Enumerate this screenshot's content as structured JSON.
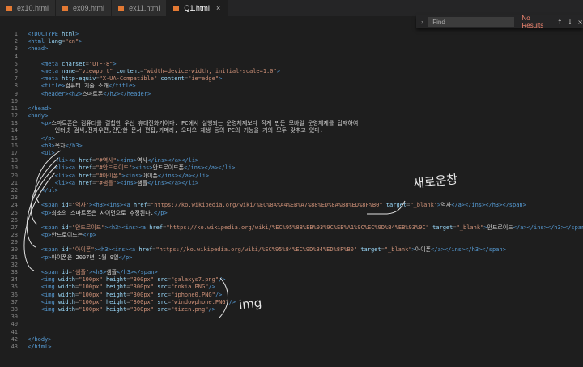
{
  "tabs": [
    {
      "label": "ex10.html",
      "active": false
    },
    {
      "label": "ex09.html",
      "active": false
    },
    {
      "label": "ex11.html",
      "active": false
    },
    {
      "label": "Q1.html",
      "active": true
    }
  ],
  "close_glyph": "×",
  "find": {
    "placeholder": "Find",
    "result": "No Results"
  },
  "annotations": {
    "new_window": "새로운창",
    "img": "img"
  },
  "lines": [
    {
      "n": "1",
      "tokens": [
        [
          "tg",
          "<!DOCTYPE "
        ],
        [
          "at",
          "html"
        ],
        [
          "tg",
          ">"
        ]
      ]
    },
    {
      "n": "2",
      "tokens": [
        [
          "tg",
          "<html "
        ],
        [
          "at",
          "lang"
        ],
        [
          "pu",
          "="
        ],
        [
          "st",
          "\"en\""
        ],
        [
          "tg",
          ">"
        ]
      ]
    },
    {
      "n": "3",
      "tokens": [
        [
          "tg",
          "<head>"
        ]
      ]
    },
    {
      "n": "4",
      "tokens": []
    },
    {
      "n": "5",
      "tokens": [
        [
          "tx",
          "    "
        ],
        [
          "tg",
          "<meta "
        ],
        [
          "at",
          "charset"
        ],
        [
          "pu",
          "="
        ],
        [
          "st",
          "\"UTF-8\""
        ],
        [
          "tg",
          ">"
        ]
      ]
    },
    {
      "n": "6",
      "tokens": [
        [
          "tx",
          "    "
        ],
        [
          "tg",
          "<meta "
        ],
        [
          "at",
          "name"
        ],
        [
          "pu",
          "="
        ],
        [
          "st",
          "\"viewport\" "
        ],
        [
          "at",
          "content"
        ],
        [
          "pu",
          "="
        ],
        [
          "st",
          "\"width=device-width, initial-scale=1.0\""
        ],
        [
          "tg",
          ">"
        ]
      ]
    },
    {
      "n": "7",
      "tokens": [
        [
          "tx",
          "    "
        ],
        [
          "tg",
          "<meta "
        ],
        [
          "at",
          "http-equiv"
        ],
        [
          "pu",
          "="
        ],
        [
          "st",
          "\"X-UA-Compatible\" "
        ],
        [
          "at",
          "content"
        ],
        [
          "pu",
          "="
        ],
        [
          "st",
          "\"ie=edge\""
        ],
        [
          "tg",
          ">"
        ]
      ]
    },
    {
      "n": "8",
      "tokens": [
        [
          "tx",
          "    "
        ],
        [
          "tg",
          "<title>"
        ],
        [
          "tx",
          "컴퓨터 기술 소개"
        ],
        [
          "tg",
          "</title>"
        ]
      ]
    },
    {
      "n": "9",
      "tokens": [
        [
          "tx",
          "    "
        ],
        [
          "tg",
          "<header><h2>"
        ],
        [
          "tx",
          "스마트폰"
        ],
        [
          "tg",
          "</h2></header>"
        ]
      ]
    },
    {
      "n": "10",
      "tokens": []
    },
    {
      "n": "11",
      "tokens": [
        [
          "tg",
          "</head>"
        ]
      ]
    },
    {
      "n": "12",
      "tokens": [
        [
          "tg",
          "<body>"
        ]
      ]
    },
    {
      "n": "13",
      "tokens": [
        [
          "tx",
          "    "
        ],
        [
          "tg",
          "<p>"
        ],
        [
          "tx",
          "스마트폰은 컴퓨터를 결합한 우선 휴대전화기이다. PC에서 실행되는 운영체제보다 작게 만든 모바일 운영체제를 탑재하여"
        ]
      ]
    },
    {
      "n": "14",
      "tokens": [
        [
          "tx",
          "        인터넷 검색,전자우편,간단한 문서 편집,카메라, 오디오 재생 등의 PC의 기능을 거의 모두 갖추고 있다."
        ]
      ]
    },
    {
      "n": "15",
      "tokens": [
        [
          "tx",
          "    "
        ],
        [
          "tg",
          "</p>"
        ]
      ]
    },
    {
      "n": "16",
      "tokens": [
        [
          "tx",
          "    "
        ],
        [
          "tg",
          "<h3>"
        ],
        [
          "tx",
          "목차"
        ],
        [
          "tg",
          "</h3>"
        ]
      ]
    },
    {
      "n": "17",
      "tokens": [
        [
          "tx",
          "    "
        ],
        [
          "tg",
          "<ul>"
        ]
      ]
    },
    {
      "n": "18",
      "tokens": [
        [
          "tx",
          "        "
        ],
        [
          "tg",
          "<li><a "
        ],
        [
          "at",
          "href"
        ],
        [
          "pu",
          "="
        ],
        [
          "st",
          "\"#역사\""
        ],
        [
          "tg",
          "><ins>"
        ],
        [
          "tx",
          "역사"
        ],
        [
          "tg",
          "</ins></a></li>"
        ]
      ]
    },
    {
      "n": "19",
      "tokens": [
        [
          "tx",
          "        "
        ],
        [
          "tg",
          "<li><a "
        ],
        [
          "at",
          "href"
        ],
        [
          "pu",
          "="
        ],
        [
          "st",
          "\"#안드로이드\""
        ],
        [
          "tg",
          "><ins>"
        ],
        [
          "tx",
          "안드로이드폰"
        ],
        [
          "tg",
          "</ins></a></li>"
        ]
      ]
    },
    {
      "n": "20",
      "tokens": [
        [
          "tx",
          "        "
        ],
        [
          "tg",
          "<li><a "
        ],
        [
          "at",
          "href"
        ],
        [
          "pu",
          "="
        ],
        [
          "st",
          "\"#아이폰\""
        ],
        [
          "tg",
          "><ins>"
        ],
        [
          "tx",
          "아이폰"
        ],
        [
          "tg",
          "</ins></a></li>"
        ]
      ]
    },
    {
      "n": "21",
      "tokens": [
        [
          "tx",
          "        "
        ],
        [
          "tg",
          "<li><a "
        ],
        [
          "at",
          "href"
        ],
        [
          "pu",
          "="
        ],
        [
          "st",
          "\"#샘플\""
        ],
        [
          "tg",
          "><ins>"
        ],
        [
          "tx",
          "샘플"
        ],
        [
          "tg",
          "</ins></a></li>"
        ]
      ]
    },
    {
      "n": "22",
      "tokens": [
        [
          "tx",
          "    "
        ],
        [
          "tg",
          "</ul>"
        ]
      ]
    },
    {
      "n": "23",
      "tokens": []
    },
    {
      "n": "24",
      "tokens": [
        [
          "tx",
          "    "
        ],
        [
          "tg",
          "<span "
        ],
        [
          "at",
          "id"
        ],
        [
          "pu",
          "="
        ],
        [
          "st",
          "\"역사\""
        ],
        [
          "tg",
          "><h3><ins><a "
        ],
        [
          "at",
          "href"
        ],
        [
          "pu",
          "="
        ],
        [
          "st",
          "\"https://ko.wikipedia.org/wiki/%EC%8A%A4%EB%A7%88%ED%8A%B8%ED%8F%B0\" "
        ],
        [
          "at",
          "target"
        ],
        [
          "pu",
          "="
        ],
        [
          "st",
          "\"_blank\""
        ],
        [
          "tg",
          ">"
        ],
        [
          "tx",
          "역사"
        ],
        [
          "tg",
          "</a></ins></h3></span>"
        ]
      ]
    },
    {
      "n": "25",
      "tokens": [
        [
          "tx",
          "    "
        ],
        [
          "tg",
          "<p>"
        ],
        [
          "tx",
          "최초의 스마트폰은 사이먼으로 추정된다."
        ],
        [
          "tg",
          "</p>"
        ]
      ]
    },
    {
      "n": "26",
      "tokens": []
    },
    {
      "n": "27",
      "tokens": [
        [
          "tx",
          "    "
        ],
        [
          "tg",
          "<span "
        ],
        [
          "at",
          "id"
        ],
        [
          "pu",
          "="
        ],
        [
          "st",
          "\"안드로이드\""
        ],
        [
          "tg",
          "><h3><ins><a "
        ],
        [
          "at",
          "href"
        ],
        [
          "pu",
          "="
        ],
        [
          "st",
          "\"https://ko.wikipedia.org/wiki/%EC%95%88%EB%93%9C%EB%A1%9C%EC%9D%B4%EB%93%9C\" "
        ],
        [
          "at",
          "target"
        ],
        [
          "pu",
          "="
        ],
        [
          "st",
          "\"_blank\""
        ],
        [
          "tg",
          ">"
        ],
        [
          "tx",
          "안드로이드"
        ],
        [
          "tg",
          "</a></ins></h3></span>"
        ]
      ]
    },
    {
      "n": "28",
      "tokens": [
        [
          "tx",
          "    "
        ],
        [
          "tg",
          "<p>"
        ],
        [
          "tx",
          "안드로이드는"
        ],
        [
          "tg",
          "</p>"
        ]
      ]
    },
    {
      "n": "29",
      "tokens": []
    },
    {
      "n": "30",
      "tokens": [
        [
          "tx",
          "    "
        ],
        [
          "tg",
          "<span "
        ],
        [
          "at",
          "id"
        ],
        [
          "pu",
          "="
        ],
        [
          "st",
          "\"아이폰\""
        ],
        [
          "tg",
          "><h3><ins><a "
        ],
        [
          "at",
          "href"
        ],
        [
          "pu",
          "="
        ],
        [
          "st",
          "\"https://ko.wikipedia.org/wiki/%EC%95%84%EC%9D%B4%ED%8F%B0\" "
        ],
        [
          "at",
          "target"
        ],
        [
          "pu",
          "="
        ],
        [
          "st",
          "\"_blank\""
        ],
        [
          "tg",
          ">"
        ],
        [
          "tx",
          "아이폰"
        ],
        [
          "tg",
          "</a></ins></h3></span>"
        ]
      ]
    },
    {
      "n": "31",
      "tokens": [
        [
          "tx",
          "    "
        ],
        [
          "tg",
          "<p>"
        ],
        [
          "tx",
          "아이폰은 2007년 1월 9일"
        ],
        [
          "tg",
          "</p>"
        ]
      ]
    },
    {
      "n": "32",
      "tokens": []
    },
    {
      "n": "33",
      "tokens": [
        [
          "tx",
          "    "
        ],
        [
          "tg",
          "<span "
        ],
        [
          "at",
          "id"
        ],
        [
          "pu",
          "="
        ],
        [
          "st",
          "\"샘플\""
        ],
        [
          "tg",
          "><h3>"
        ],
        [
          "tx",
          "샘플"
        ],
        [
          "tg",
          "</h3></span>"
        ]
      ]
    },
    {
      "n": "34",
      "tokens": [
        [
          "tx",
          "    "
        ],
        [
          "tg",
          "<img "
        ],
        [
          "at",
          "width"
        ],
        [
          "pu",
          "="
        ],
        [
          "st",
          "\"100px\" "
        ],
        [
          "at",
          "height"
        ],
        [
          "pu",
          "="
        ],
        [
          "st",
          "\"300px\" "
        ],
        [
          "at",
          "src"
        ],
        [
          "pu",
          "="
        ],
        [
          "st",
          "\"galaxys7.png\""
        ],
        [
          "tg",
          "/>"
        ]
      ]
    },
    {
      "n": "35",
      "tokens": [
        [
          "tx",
          "    "
        ],
        [
          "tg",
          "<img "
        ],
        [
          "at",
          "width"
        ],
        [
          "pu",
          "="
        ],
        [
          "st",
          "\"100px\" "
        ],
        [
          "at",
          "height"
        ],
        [
          "pu",
          "="
        ],
        [
          "st",
          "\"300px\" "
        ],
        [
          "at",
          "src"
        ],
        [
          "pu",
          "="
        ],
        [
          "st",
          "\"nokia.PNG\""
        ],
        [
          "tg",
          "/>"
        ]
      ]
    },
    {
      "n": "36",
      "tokens": [
        [
          "tx",
          "    "
        ],
        [
          "tg",
          "<img "
        ],
        [
          "at",
          "width"
        ],
        [
          "pu",
          "="
        ],
        [
          "st",
          "\"100px\" "
        ],
        [
          "at",
          "height"
        ],
        [
          "pu",
          "="
        ],
        [
          "st",
          "\"300px\" "
        ],
        [
          "at",
          "src"
        ],
        [
          "pu",
          "="
        ],
        [
          "st",
          "\"iphone0.PNG\""
        ],
        [
          "tg",
          "/>"
        ]
      ]
    },
    {
      "n": "37",
      "tokens": [
        [
          "tx",
          "    "
        ],
        [
          "tg",
          "<img "
        ],
        [
          "at",
          "width"
        ],
        [
          "pu",
          "="
        ],
        [
          "st",
          "\"100px\" "
        ],
        [
          "at",
          "height"
        ],
        [
          "pu",
          "="
        ],
        [
          "st",
          "\"300px\" "
        ],
        [
          "at",
          "src"
        ],
        [
          "pu",
          "="
        ],
        [
          "st",
          "\"windowphone.PNG\""
        ],
        [
          "tg",
          "/>"
        ]
      ]
    },
    {
      "n": "38",
      "tokens": [
        [
          "tx",
          "    "
        ],
        [
          "tg",
          "<img "
        ],
        [
          "at",
          "width"
        ],
        [
          "pu",
          "="
        ],
        [
          "st",
          "\"100px\" "
        ],
        [
          "at",
          "height"
        ],
        [
          "pu",
          "="
        ],
        [
          "st",
          "\"300px\" "
        ],
        [
          "at",
          "src"
        ],
        [
          "pu",
          "="
        ],
        [
          "st",
          "\"tizen.png\""
        ],
        [
          "tg",
          "/>"
        ]
      ]
    },
    {
      "n": "39",
      "tokens": []
    },
    {
      "n": "40",
      "tokens": []
    },
    {
      "n": "41",
      "tokens": []
    },
    {
      "n": "42",
      "tokens": [
        [
          "tg",
          "</body>"
        ]
      ]
    },
    {
      "n": "43",
      "tokens": [
        [
          "tg",
          "</html>"
        ]
      ]
    }
  ]
}
